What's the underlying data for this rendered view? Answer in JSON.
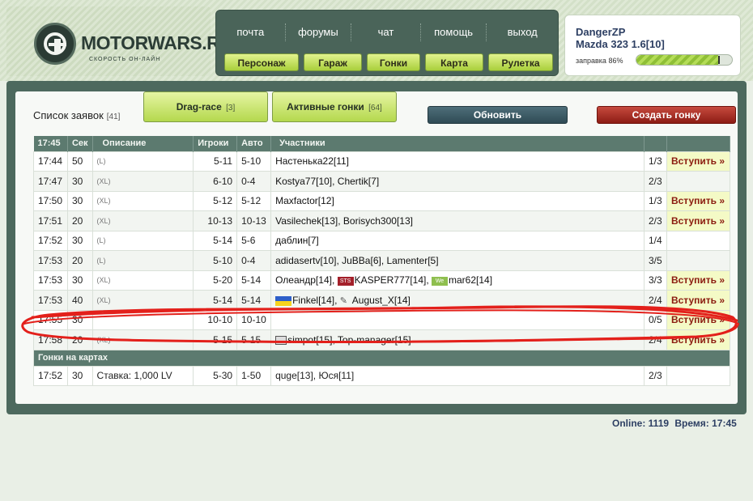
{
  "site": {
    "logo_text": "MOTORWARS.RU",
    "logo_subtitle": "СКОРОСТЬ ОН-ЛАЙН"
  },
  "nav": {
    "top": [
      "почта",
      "форумы",
      "чат",
      "помощь",
      "выход"
    ],
    "bottom": [
      "Персонаж",
      "Гараж",
      "Гонки",
      "Карта",
      "Рулетка"
    ]
  },
  "user": {
    "name": "DangerZP",
    "car": "Mazda 323 1.6[10]",
    "fuel_label": "заправка 86%",
    "fuel_percent": 86
  },
  "panel": {
    "list_title": "Список заявок",
    "list_count": "[41]",
    "tabs": [
      {
        "label": "Drag-race",
        "count": "[3]"
      },
      {
        "label": "Активные гонки",
        "count": "[64]"
      }
    ],
    "refresh_label": "Обновить",
    "create_label": "Создать гонку"
  },
  "table": {
    "headers": [
      "17:45",
      "Сек",
      "Описание",
      "Игроки",
      "Авто",
      "Участники"
    ],
    "rows": [
      {
        "time": "17:44",
        "sec": "50",
        "desc": "(L)",
        "players": "5-11",
        "auto": "5-10",
        "participants": "Настенька22[11]",
        "count": "1/3",
        "join": "Вступить »"
      },
      {
        "time": "17:47",
        "sec": "30",
        "desc": "(XL)",
        "players": "6-10",
        "auto": "0-4",
        "participants": "Kostya77[10], Chertik[7]",
        "count": "2/3",
        "join": ""
      },
      {
        "time": "17:50",
        "sec": "30",
        "desc": "(XL)",
        "players": "5-12",
        "auto": "5-12",
        "participants": "Maxfactor[12]",
        "count": "1/3",
        "join": "Вступить »"
      },
      {
        "time": "17:51",
        "sec": "20",
        "desc": "(XL)",
        "players": "10-13",
        "auto": "10-13",
        "participants": "Vasilechek[13], Borisych300[13]",
        "count": "2/3",
        "join": "Вступить »"
      },
      {
        "time": "17:52",
        "sec": "30",
        "desc": "(L)",
        "players": "5-14",
        "auto": "5-6",
        "participants": "даблин[7]",
        "count": "1/4",
        "join": ""
      },
      {
        "time": "17:53",
        "sec": "20",
        "desc": "(L)",
        "players": "5-10",
        "auto": "0-4",
        "participants": "adidasertv[10], JuBBa[6], Lamenter[5]",
        "count": "3/5",
        "join": ""
      },
      {
        "time": "17:53",
        "sec": "30",
        "desc": "(XL)",
        "players": "5-20",
        "auto": "5-14",
        "participants": "Олеандр[14], ",
        "participants_b": "KASPER777[14], ",
        "participants_c": "mar62[14]",
        "count": "3/3",
        "join": "Вступить »"
      },
      {
        "time": "17:53",
        "sec": "40",
        "desc": "(XL)",
        "players": "5-14",
        "auto": "5-14",
        "participants": "Finkel[14], ",
        "participants_b": "August_X[14]",
        "count": "2/4",
        "join": "Вступить »"
      },
      {
        "time": "17:55",
        "sec": "30",
        "desc": "",
        "players": "10-10",
        "auto": "10-10",
        "participants": "",
        "count": "0/5",
        "join": "Вступить »"
      },
      {
        "time": "17:58",
        "sec": "20",
        "desc": "(XL)",
        "players": "5-15",
        "auto": "5-15",
        "participants": "simpot[15], Top-manager[15]",
        "count": "2/4",
        "join": "Вступить »"
      }
    ],
    "section_title": "Гонки на картах",
    "map_row": {
      "time": "17:52",
      "sec": "30",
      "desc": "Ставка: 1,000 LV",
      "players": "5-30",
      "auto": "1-50",
      "participants": "quge[13], Юся[11]",
      "count": "2/3",
      "join": ""
    }
  },
  "flags": {
    "row7_b": "STS",
    "row7_c": "We"
  },
  "status": {
    "online": "Online: 1119",
    "time": "Время: 17:45"
  },
  "colors": {
    "frame": "#4d695e",
    "table_header": "#5c7a6f",
    "join_text": "#8b1c10",
    "scribble": "#e3201b"
  }
}
